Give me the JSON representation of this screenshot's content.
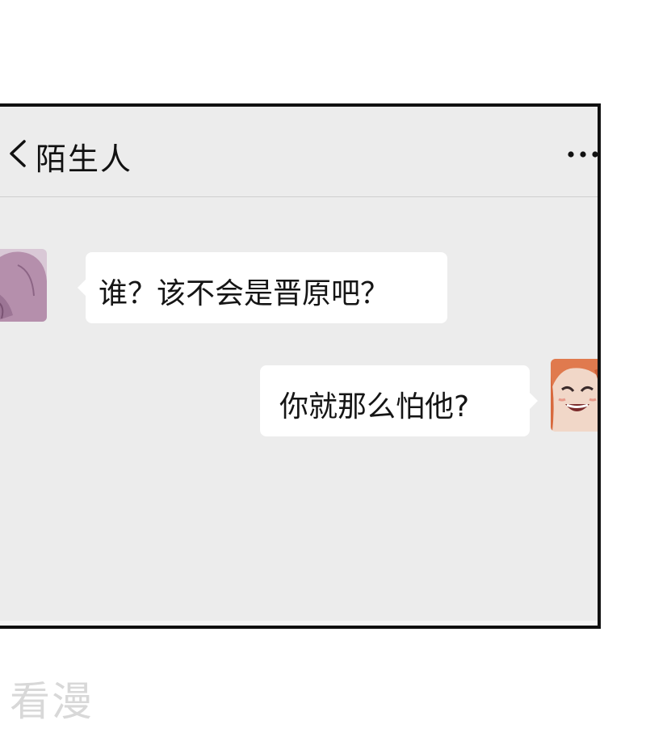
{
  "header": {
    "back_icon": "chevron-left-icon",
    "title": "陌生人",
    "more_icon": "more-horizontal-icon"
  },
  "messages": [
    {
      "side": "left",
      "avatar": "contact-avatar",
      "text": "谁？该不会是晋原吧？"
    },
    {
      "side": "right",
      "avatar": "user-avatar",
      "text": "你就那么怕他?"
    }
  ],
  "watermark": "看漫",
  "colors": {
    "chat_background": "#ececec",
    "bubble": "#ffffff",
    "frame": "#111111"
  }
}
